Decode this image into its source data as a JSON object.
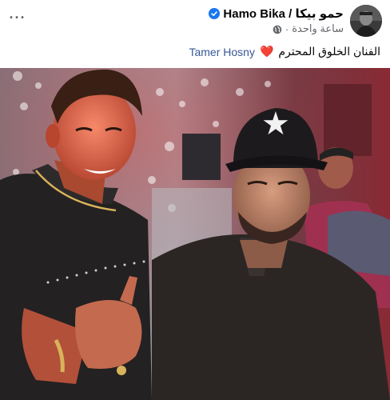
{
  "post": {
    "author_name": "Hamo Bika / حمو بيكا",
    "timestamp": "ساعة واحدة",
    "separator": "·",
    "audience_icon": "globe-icon",
    "verified_icon": "verified-badge-icon",
    "menu_label": "···",
    "caption": {
      "text": "الفنان الخلوق المحترم",
      "emoji": "❤️",
      "mention": "Tamer Hosny"
    },
    "photo": {
      "cap_icon": "star-icon",
      "cap_star": "★"
    }
  },
  "colors": {
    "brand_blue": "#1877f2",
    "mention_blue": "#385898",
    "secondary_text": "#65676b",
    "heart_red": "#e0245e"
  }
}
